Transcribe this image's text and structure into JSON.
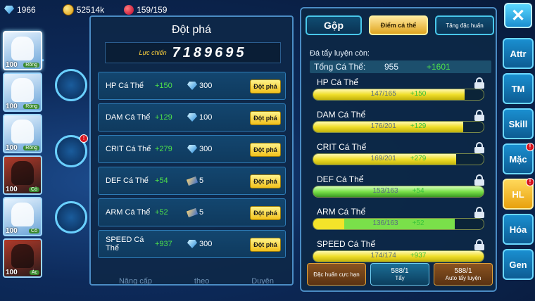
{
  "topbar": {
    "diamonds": "1966",
    "gold": "52514k",
    "stamina": "159/159"
  },
  "pets": [
    {
      "level": "100",
      "tag": "Rồng"
    },
    {
      "level": "100",
      "tag": "Rồng"
    },
    {
      "level": "100",
      "tag": "Rồng"
    },
    {
      "level": "100",
      "tag": "Cỏ"
    },
    {
      "level": "100",
      "tag": "Cỏ"
    },
    {
      "level": "100",
      "tag": "Ác"
    }
  ],
  "center": {
    "title": "Đột phá",
    "power_label": "Lực chiến",
    "power_value": "7189695",
    "rows": [
      {
        "name": "HP Cá Thể",
        "inc": "+150",
        "cost": "300",
        "icon": "diamond-icon"
      },
      {
        "name": "DAM Cá Thể",
        "inc": "+129",
        "cost": "100",
        "icon": "diamond-icon"
      },
      {
        "name": "CRIT Cá Thể",
        "inc": "+279",
        "cost": "300",
        "icon": "diamond-icon"
      },
      {
        "name": "DEF Cá Thể",
        "inc": "+54",
        "cost": "5",
        "icon": "scroll-icon"
      },
      {
        "name": "ARM Cá Thể",
        "inc": "+52",
        "cost": "5",
        "icon": "scroll-icon"
      },
      {
        "name": "SPEED Cá Thể",
        "inc": "+937",
        "cost": "300",
        "icon": "diamond-icon"
      }
    ],
    "button_label": "Đột phá",
    "bottom_tabs": [
      "Nâng cấp",
      "theo",
      "Duyên"
    ]
  },
  "right": {
    "tabs": [
      "Gộp",
      "Điểm cá thể",
      "Tăng đặc huấn"
    ],
    "info": "Đá tẩy luyện còn:",
    "total_label": "Tổng Cá Thể:",
    "total_value": "955",
    "total_inc": "+1601",
    "stats": [
      {
        "name": "HP Cá Thể",
        "value": "147/165",
        "inc": "+150",
        "progress": 0.89,
        "style": "yellow"
      },
      {
        "name": "DAM Cá Thể",
        "value": "176/201",
        "inc": "+129",
        "progress": 0.88,
        "style": "yellow"
      },
      {
        "name": "CRIT Cá Thể",
        "value": "169/201",
        "inc": "+279",
        "progress": 0.84,
        "style": "yellow"
      },
      {
        "name": "DEF Cá Thể",
        "value": "153/163",
        "inc": "+54",
        "progress": 1.0,
        "style": "green"
      },
      {
        "name": "ARM Cá Thể",
        "value": "136/163",
        "inc": "+52",
        "progress": 0.83,
        "style": "mix"
      },
      {
        "name": "SPEED Cá Thể",
        "value": "174/174",
        "inc": "+937",
        "progress": 1.0,
        "style": "yellow"
      }
    ],
    "actions": [
      {
        "label": "Đặc huấn cực hạn",
        "count": ""
      },
      {
        "label": "Tẩy",
        "count": "588/1"
      },
      {
        "label": "Auto tẩy luyện",
        "count": "588/1"
      }
    ]
  },
  "sidebar": {
    "close": "✕",
    "items": [
      "Attr",
      "TM",
      "Skill",
      "Mặc",
      "HL",
      "Hóa",
      "Gen"
    ]
  }
}
